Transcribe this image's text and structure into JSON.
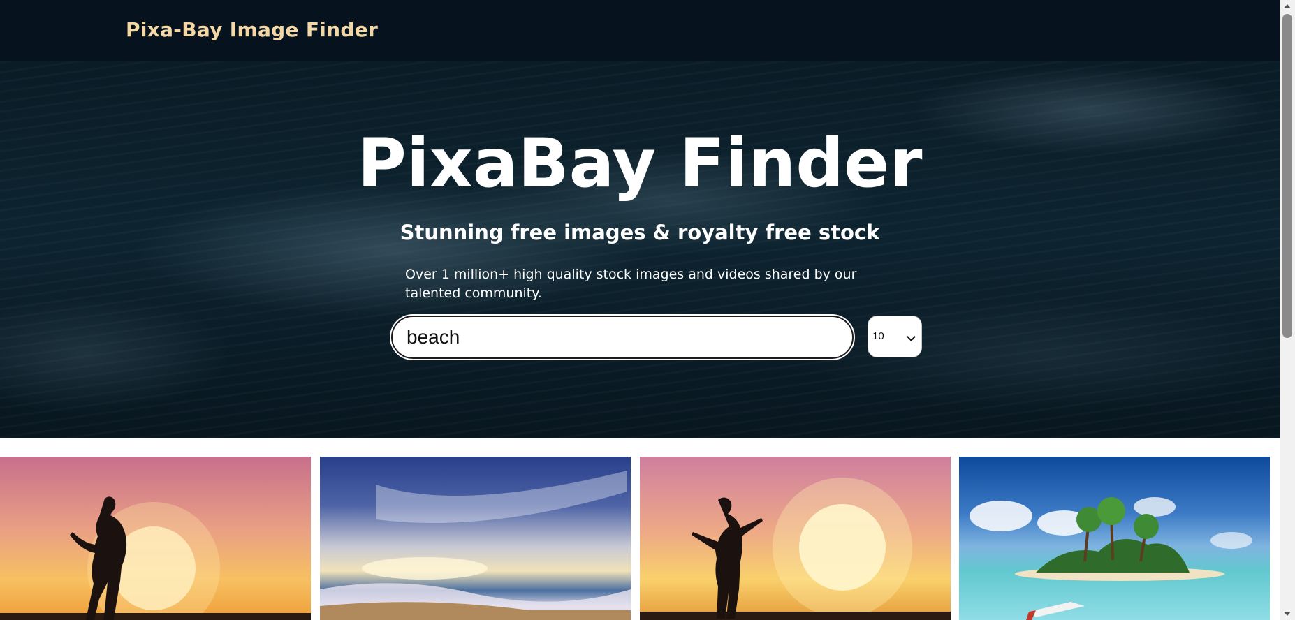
{
  "navbar": {
    "brand": "Pixa-Bay Image Finder"
  },
  "hero": {
    "title": "PixaBay Finder",
    "subtitle": "Stunning free images & royalty free stock",
    "description": "Over 1 million+ high quality stock images and videos shared by our talented community.",
    "search_value": "beach",
    "count_selected": "10"
  },
  "gallery": {
    "images": [
      {
        "subject": "woman silhouette at sunset on beach"
      },
      {
        "subject": "sunset over ocean waves with dramatic sky"
      },
      {
        "subject": "woman with open arms silhouette at sunset"
      },
      {
        "subject": "tropical island with palm trees and boat"
      }
    ]
  },
  "colors": {
    "navbar_bg": "#06131f",
    "brand_text": "#f3d8a6",
    "hero_bg": "#0d2430"
  }
}
